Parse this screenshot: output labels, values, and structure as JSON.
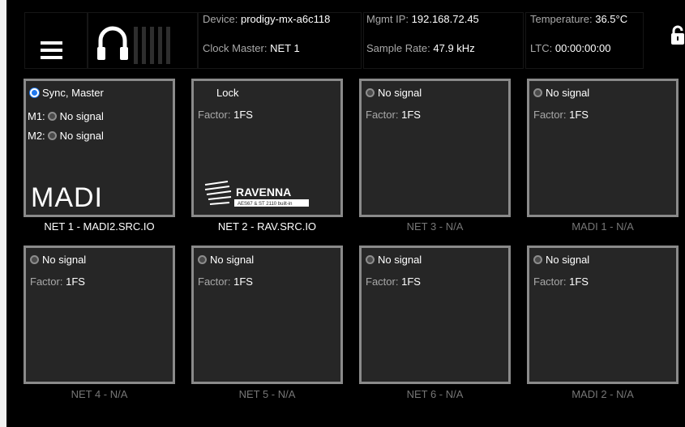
{
  "header": {
    "device_label": "Device:",
    "device_value": "prodigy-mx-a6c118",
    "mgmt_ip_label": "Mgmt IP:",
    "mgmt_ip_value": "192.168.72.45",
    "temperature_label": "Temperature:",
    "temperature_value": "36.5°C",
    "clock_master_label": "Clock Master:",
    "clock_master_value": "NET 1",
    "sample_rate_label": "Sample Rate:",
    "sample_rate_value": "47.9 kHz",
    "ltc_label": "LTC:",
    "ltc_value": "00:00:00:00"
  },
  "icons": {
    "menu": "hamburger-menu-icon",
    "headphones": "headphones-icon",
    "meter": "level-meter-icon",
    "lock": "lock-icon"
  },
  "colors": {
    "background": "#000000",
    "tile": "#262626",
    "tile_border": "#8a8a8a",
    "active_radio": "#1e78f0",
    "muted_text": "#a8a8a8",
    "inactive_label": "#767676"
  },
  "tiles": [
    {
      "status": "Sync, Master",
      "m1_label": "M1:",
      "m1_status": "No signal",
      "m2_label": "M2:",
      "m2_status": "No signal",
      "logo": "MADI",
      "label": "NET 1 - MADI2.SRC.IO"
    },
    {
      "status": "Lock",
      "factor_label": "Factor:",
      "factor_value": "1FS",
      "logo_main": "RAVENNA",
      "logo_sub": "AES67 & ST 2110 built-in",
      "label": "NET 2 - RAV.SRC.IO"
    },
    {
      "status": "No signal",
      "factor_label": "Factor:",
      "factor_value": "1FS",
      "label": "NET 3 - N/A"
    },
    {
      "status": "No signal",
      "factor_label": "Factor:",
      "factor_value": "1FS",
      "label": "MADI 1 - N/A"
    },
    {
      "status": "No signal",
      "factor_label": "Factor:",
      "factor_value": "1FS",
      "label": "NET 4 - N/A"
    },
    {
      "status": "No signal",
      "factor_label": "Factor:",
      "factor_value": "1FS",
      "label": "NET 5 - N/A"
    },
    {
      "status": "No signal",
      "factor_label": "Factor:",
      "factor_value": "1FS",
      "label": "NET 6 - N/A"
    },
    {
      "status": "No signal",
      "factor_label": "Factor:",
      "factor_value": "1FS",
      "label": "MADI 2 - N/A"
    }
  ]
}
